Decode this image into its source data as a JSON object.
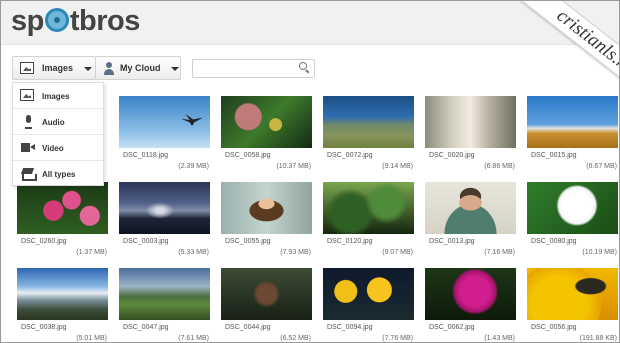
{
  "header": {
    "logo_text_start": "sp",
    "logo_text_end": "tbros",
    "watermark": "cristianls.ro"
  },
  "toolbar": {
    "type_dropdown_label": "Images",
    "cloud_dropdown_label": "My Cloud",
    "search_value": "",
    "search_placeholder": ""
  },
  "type_menu": {
    "items": [
      {
        "label": "Images",
        "icon": "image-icon"
      },
      {
        "label": "Audio",
        "icon": "microphone-icon"
      },
      {
        "label": "Video",
        "icon": "video-camera-icon"
      },
      {
        "label": "All types",
        "icon": "stack-icon"
      }
    ]
  },
  "files": [
    {
      "name": "DSC_0118.jpg",
      "size": "(2.39 MB)",
      "scene": "sky"
    },
    {
      "name": "DSC_0058.jpg",
      "size": "(10.37 MB)",
      "scene": "leafy"
    },
    {
      "name": "DSC_0072.jpg",
      "size": "(9.14 MB)",
      "scene": "field"
    },
    {
      "name": "DSC_0020.jpg",
      "size": "(6.86 MB)",
      "scene": "alley"
    },
    {
      "name": "DSC_0015.jpg",
      "size": "(6.67 MB)",
      "scene": "town"
    },
    {
      "name": "DSC_0260.jpg",
      "size": "(1.37 MB)",
      "scene": "pink"
    },
    {
      "name": "DSC_0003.jpg",
      "size": "(5.33 MB)",
      "scene": "sunset"
    },
    {
      "name": "DSC_0055.jpg",
      "size": "(7.93 MB)",
      "scene": "woman"
    },
    {
      "name": "DSC_0120.jpg",
      "size": "(9.07 MB)",
      "scene": "forest"
    },
    {
      "name": "DSC_0013.jpg",
      "size": "(7.16 MB)",
      "scene": "man"
    },
    {
      "name": "DSC_0080.jpg",
      "size": "(10.19 MB)",
      "scene": "white"
    },
    {
      "name": "DSC_0038.jpg",
      "size": "(5.01 MB)",
      "scene": "city"
    },
    {
      "name": "DSC_0047.jpg",
      "size": "(7.61 MB)",
      "scene": "hills"
    },
    {
      "name": "DSC_0044.jpg",
      "size": "(6.52 MB)",
      "scene": "seed"
    },
    {
      "name": "DSC_0094.jpg",
      "size": "(7.76 MB)",
      "scene": "yellow"
    },
    {
      "name": "DSC_0062.jpg",
      "size": "(1.43 MB)",
      "scene": "magenta"
    },
    {
      "name": "DSC_0056.jpg",
      "size": "(191.88 KB)",
      "scene": "bee"
    }
  ]
}
